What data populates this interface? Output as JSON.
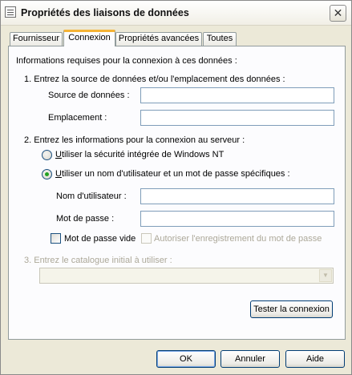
{
  "window": {
    "title": "Propriétés des liaisons de données",
    "close_glyph": "✕"
  },
  "tabs": [
    {
      "label": "Fournisseur",
      "active": false
    },
    {
      "label": "Connexion",
      "active": true
    },
    {
      "label": "Propriétés avancées",
      "active": false
    },
    {
      "label": "Toutes",
      "active": false
    }
  ],
  "connection": {
    "intro": "Informations requises pour la connexion à ces données :",
    "step1": {
      "heading": "1. Entrez la source de données et/ou l'emplacement des données :",
      "datasource_label": "Source de données :",
      "datasource_value": "",
      "location_label": "Emplacement :",
      "location_value": ""
    },
    "step2": {
      "heading": "2. Entrez les informations pour la connexion au serveur :",
      "radio_nt_first": "U",
      "radio_nt_rest": "tiliser la sécurité intégrée de Windows NT",
      "radio_nt_checked": false,
      "radio_specific_first": "U",
      "radio_specific_rest": "tiliser un nom d'utilisateur et un mot de passe spécifiques :",
      "radio_specific_checked": true,
      "username_label": "Nom d'utilisateur :",
      "username_value": "",
      "password_label": "Mot de passe :",
      "password_value": "",
      "blank_password_label": "Mot de passe vide",
      "blank_password_checked": false,
      "save_password_label": "Autoriser l'enregistrement du mot de passe",
      "save_password_enabled": false
    },
    "step3": {
      "heading": "3. Entrez le catalogue initial à utiliser :",
      "catalog_value": ""
    },
    "test_button": "Tester la connexion"
  },
  "footer": {
    "ok": "OK",
    "cancel": "Annuler",
    "help": "Aide"
  },
  "colors": {
    "active_tab_accent": "#f5b335",
    "radio_selected": "#21a121"
  }
}
